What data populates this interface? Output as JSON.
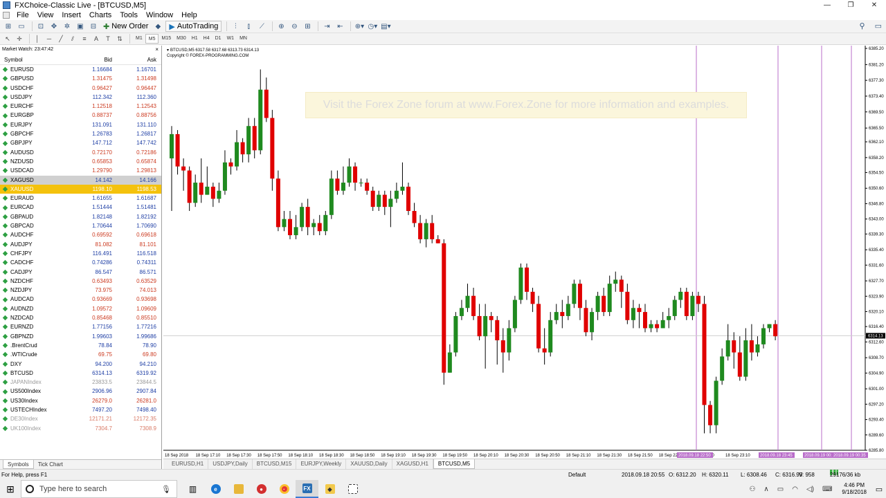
{
  "window": {
    "title": "FXChoice-Classic Live - [BTCUSD,M5]",
    "controls": [
      "—",
      "❐",
      "✕"
    ]
  },
  "menu": [
    "File",
    "View",
    "Insert",
    "Charts",
    "Tools",
    "Window",
    "Help"
  ],
  "toolbar": {
    "new_order": "New Order",
    "autotrading": "AutoTrading"
  },
  "timeframes": [
    "M1",
    "M5",
    "M15",
    "M30",
    "H1",
    "H4",
    "D1",
    "W1",
    "MN"
  ],
  "active_timeframe": "M5",
  "market_watch": {
    "title": "Market Watch: 23:47:42",
    "close": "×",
    "headers": {
      "symbol": "Symbol",
      "bid": "Bid",
      "ask": "Ask"
    },
    "rows": [
      {
        "symbol": "EURUSD",
        "bid": "1.16684",
        "ask": "1.16701",
        "state": "up"
      },
      {
        "symbol": "GBPUSD",
        "bid": "1.31475",
        "ask": "1.31498",
        "state": "down"
      },
      {
        "symbol": "USDCHF",
        "bid": "0.96427",
        "ask": "0.96447",
        "state": "down"
      },
      {
        "symbol": "USDJPY",
        "bid": "112.342",
        "ask": "112.360",
        "state": "up"
      },
      {
        "symbol": "EURCHF",
        "bid": "1.12518",
        "ask": "1.12543",
        "state": "down"
      },
      {
        "symbol": "EURGBP",
        "bid": "0.88737",
        "ask": "0.88756",
        "state": "down"
      },
      {
        "symbol": "EURJPY",
        "bid": "131.091",
        "ask": "131.110",
        "state": "up"
      },
      {
        "symbol": "GBPCHF",
        "bid": "1.26783",
        "ask": "1.26817",
        "state": "up"
      },
      {
        "symbol": "GBPJPY",
        "bid": "147.712",
        "ask": "147.742",
        "state": "up"
      },
      {
        "symbol": "AUDUSD",
        "bid": "0.72170",
        "ask": "0.72186",
        "state": "down"
      },
      {
        "symbol": "NZDUSD",
        "bid": "0.65853",
        "ask": "0.65874",
        "state": "down"
      },
      {
        "symbol": "USDCAD",
        "bid": "1.29790",
        "ask": "1.29813",
        "state": "down"
      },
      {
        "symbol": "XAGUSD",
        "bid": "14.142",
        "ask": "14.166",
        "state": "sel-gray"
      },
      {
        "symbol": "XAUUSD",
        "bid": "1198.10",
        "ask": "1198.53",
        "state": "sel-gold"
      },
      {
        "symbol": "EURAUD",
        "bid": "1.61655",
        "ask": "1.61687",
        "state": "up"
      },
      {
        "symbol": "EURCAD",
        "bid": "1.51444",
        "ask": "1.51481",
        "state": "up"
      },
      {
        "symbol": "GBPAUD",
        "bid": "1.82148",
        "ask": "1.82192",
        "state": "up"
      },
      {
        "symbol": "GBPCAD",
        "bid": "1.70644",
        "ask": "1.70690",
        "state": "up"
      },
      {
        "symbol": "AUDCHF",
        "bid": "0.69592",
        "ask": "0.69618",
        "state": "down"
      },
      {
        "symbol": "AUDJPY",
        "bid": "81.082",
        "ask": "81.101",
        "state": "down"
      },
      {
        "symbol": "CHFJPY",
        "bid": "116.491",
        "ask": "116.518",
        "state": "up"
      },
      {
        "symbol": "CADCHF",
        "bid": "0.74286",
        "ask": "0.74311",
        "state": "up"
      },
      {
        "symbol": "CADJPY",
        "bid": "86.547",
        "ask": "86.571",
        "state": "up"
      },
      {
        "symbol": "NZDCHF",
        "bid": "0.63493",
        "ask": "0.63529",
        "state": "down"
      },
      {
        "symbol": "NZDJPY",
        "bid": "73.975",
        "ask": "74.013",
        "state": "down"
      },
      {
        "symbol": "AUDCAD",
        "bid": "0.93669",
        "ask": "0.93698",
        "state": "down"
      },
      {
        "symbol": "AUDNZD",
        "bid": "1.09572",
        "ask": "1.09609",
        "state": "down"
      },
      {
        "symbol": "NZDCAD",
        "bid": "0.85468",
        "ask": "0.85510",
        "state": "down"
      },
      {
        "symbol": "EURNZD",
        "bid": "1.77156",
        "ask": "1.77216",
        "state": "up"
      },
      {
        "symbol": "GBPNZD",
        "bid": "1.99603",
        "ask": "1.99686",
        "state": "up"
      },
      {
        "symbol": ".BrentCrud",
        "bid": "78.84",
        "ask": "78.90",
        "state": "up"
      },
      {
        "symbol": ".WTICrude",
        "bid": "69.75",
        "ask": "69.80",
        "state": "down"
      },
      {
        "symbol": "DXY",
        "bid": "94.200",
        "ask": "94.210",
        "state": "up"
      },
      {
        "symbol": "BTCUSD",
        "bid": "6314.13",
        "ask": "6319.92",
        "state": "up"
      },
      {
        "symbol": "JAPANIndex",
        "bid": "23833.5",
        "ask": "23844.5",
        "state": "off"
      },
      {
        "symbol": "US500Index",
        "bid": "2906.96",
        "ask": "2907.84",
        "state": "up"
      },
      {
        "symbol": "US30Index",
        "bid": "26279.0",
        "ask": "26281.0",
        "state": "down"
      },
      {
        "symbol": "USTECHIndex",
        "bid": "7497.20",
        "ask": "7498.40",
        "state": "up"
      },
      {
        "symbol": "DE30Index",
        "bid": "12171.21",
        "ask": "12172.35",
        "state": "off down"
      },
      {
        "symbol": "UK100Index",
        "bid": "7304.7",
        "ask": "7308.9",
        "state": "off down"
      }
    ],
    "tabs": [
      "Symbols",
      "Tick Chart"
    ]
  },
  "chart": {
    "header_line": "BTCUSD,M5  6317.58 6317.68 6313.73 6314.13",
    "copyright": "Copyright © FOREX-PROGRAMMING.COM",
    "banner": "Visit the Forex Zone forum at www.Forex.Zone for more information and examples.",
    "current_price_label": "6314.13"
  },
  "chart_data": {
    "type": "candlestick",
    "symbol": "BTCUSD",
    "timeframe": "M5",
    "y_ticks": [
      "6385.20",
      "6381.20",
      "6377.30",
      "6373.40",
      "6369.50",
      "6365.50",
      "6362.10",
      "6358.20",
      "6354.50",
      "6350.60",
      "6346.80",
      "6343.00",
      "6339.30",
      "6335.40",
      "6331.60",
      "6327.70",
      "6323.90",
      "6320.10",
      "6316.40",
      "6312.60",
      "6308.70",
      "6304.90",
      "6301.00",
      "6297.20",
      "6293.40",
      "6289.60",
      "6285.80"
    ],
    "y_range": [
      6285.8,
      6385.2
    ],
    "x_labels": [
      "18 Sep 2018",
      "18 Sep 17:10",
      "18 Sep 17:30",
      "18 Sep 17:50",
      "18 Sep 18:10",
      "18 Sep 18:30",
      "18 Sep 18:50",
      "18 Sep 19:10",
      "18 Sep 19:30",
      "18 Sep 19:50",
      "18 Sep 20:10",
      "18 Sep 20:30",
      "18 Sep 20:50",
      "18 Sep 21:10",
      "18 Sep 21:30",
      "18 Sep 21:50",
      "18 Sep 22:10",
      "18 Sep 22:30",
      "18 Sep 23:10"
    ],
    "x_highlight_labels": [
      "2018.09.18 22:50",
      "2018.09.18 23:45",
      "2018.09.19 00:00",
      "2018.09.19 00:35"
    ],
    "candles": [
      [
        6358,
        6364,
        6366,
        6345
      ],
      [
        6364,
        6356,
        6365,
        6354
      ],
      [
        6356,
        6355,
        6358,
        6350
      ],
      [
        6355,
        6347,
        6356,
        6345
      ],
      [
        6347,
        6352,
        6354,
        6346
      ],
      [
        6352,
        6349,
        6358,
        6347
      ],
      [
        6349,
        6351,
        6356,
        6349
      ],
      [
        6351,
        6348,
        6352,
        6346
      ],
      [
        6348,
        6350,
        6352,
        6347
      ],
      [
        6350,
        6357,
        6360,
        6349
      ],
      [
        6357,
        6356,
        6358,
        6354
      ],
      [
        6356,
        6362,
        6365,
        6355
      ],
      [
        6362,
        6359,
        6363,
        6357
      ],
      [
        6359,
        6366,
        6368,
        6357
      ],
      [
        6366,
        6360,
        6368,
        6358
      ],
      [
        6360,
        6375,
        6380,
        6359
      ],
      [
        6375,
        6368,
        6378,
        6367
      ],
      [
        6368,
        6353,
        6370,
        6350
      ],
      [
        6353,
        6341,
        6355,
        6340
      ],
      [
        6341,
        6343,
        6345,
        6340
      ],
      [
        6343,
        6339,
        6345,
        6338
      ],
      [
        6339,
        6341,
        6344,
        6338
      ],
      [
        6341,
        6346,
        6347,
        6340
      ],
      [
        6346,
        6341,
        6348,
        6339
      ],
      [
        6341,
        6342,
        6343,
        6339
      ],
      [
        6342,
        6340,
        6344,
        6339
      ],
      [
        6340,
        6344,
        6345,
        6339
      ],
      [
        6344,
        6353,
        6355,
        6343
      ],
      [
        6353,
        6350,
        6355,
        6349
      ],
      [
        6350,
        6352,
        6356,
        6349
      ],
      [
        6352,
        6356,
        6358,
        6351
      ],
      [
        6356,
        6352,
        6357,
        6350
      ],
      [
        6352,
        6352,
        6353,
        6351
      ],
      [
        6352,
        6350,
        6353,
        6349
      ],
      [
        6350,
        6346,
        6351,
        6345
      ],
      [
        6346,
        6349,
        6350,
        6345
      ],
      [
        6349,
        6346,
        6350,
        6344
      ],
      [
        6346,
        6348,
        6350,
        6341
      ],
      [
        6348,
        6350,
        6352,
        6347
      ],
      [
        6350,
        6351,
        6357,
        6349
      ],
      [
        6351,
        6345,
        6352,
        6344
      ],
      [
        6345,
        6342,
        6347,
        6341
      ],
      [
        6342,
        6338,
        6344,
        6337
      ],
      [
        6338,
        6342,
        6343,
        6336
      ],
      [
        6342,
        6338,
        6344,
        6337
      ],
      [
        6338,
        6337,
        6339,
        6337
      ],
      [
        6337,
        6305,
        6338,
        6302
      ],
      [
        6305,
        6310,
        6312,
        6305
      ],
      [
        6310,
        6319,
        6320,
        6309
      ],
      [
        6319,
        6321,
        6323,
        6318
      ],
      [
        6321,
        6324,
        6327,
        6320
      ],
      [
        6324,
        6319,
        6326,
        6318
      ],
      [
        6319,
        6314,
        6322,
        6313
      ],
      [
        6314,
        6319,
        6322,
        6306
      ],
      [
        6319,
        6318,
        6320,
        6315
      ],
      [
        6318,
        6313,
        6319,
        6307
      ],
      [
        6313,
        6310,
        6316,
        6305
      ],
      [
        6310,
        6316,
        6318,
        6308
      ],
      [
        6316,
        6323,
        6324,
        6315
      ],
      [
        6323,
        6331,
        6332,
        6322
      ],
      [
        6331,
        6325,
        6332,
        6323
      ],
      [
        6325,
        6322,
        6326,
        6320
      ],
      [
        6322,
        6311,
        6324,
        6310
      ],
      [
        6311,
        6310,
        6316,
        6307
      ],
      [
        6310,
        6318,
        6320,
        6309
      ],
      [
        6318,
        6320,
        6322,
        6317
      ],
      [
        6320,
        6319,
        6323,
        6316
      ],
      [
        6319,
        6322,
        6324,
        6318
      ],
      [
        6322,
        6327,
        6328,
        6321
      ],
      [
        6327,
        6321,
        6328,
        6318
      ],
      [
        6321,
        6315,
        6323,
        6314
      ],
      [
        6315,
        6320,
        6321,
        6313
      ],
      [
        6320,
        6324,
        6325,
        6318
      ],
      [
        6324,
        6320,
        6326,
        6319
      ],
      [
        6320,
        6327,
        6329,
        6319
      ],
      [
        6327,
        6328,
        6330,
        6325
      ],
      [
        6328,
        6325,
        6329,
        6321
      ],
      [
        6325,
        6318,
        6327,
        6317
      ],
      [
        6318,
        6321,
        6323,
        6316
      ],
      [
        6321,
        6320,
        6322,
        6316
      ],
      [
        6320,
        6316,
        6322,
        6315
      ],
      [
        6316,
        6317,
        6318,
        6315
      ],
      [
        6317,
        6316,
        6318,
        6315
      ],
      [
        6316,
        6318,
        6320,
        6316
      ],
      [
        6318,
        6319,
        6321,
        6316
      ],
      [
        6319,
        6323,
        6324,
        6318
      ],
      [
        6323,
        6325,
        6326,
        6321
      ],
      [
        6325,
        6319,
        6326,
        6318
      ],
      [
        6319,
        6324,
        6325,
        6318
      ],
      [
        6324,
        6322,
        6325,
        6320
      ],
      [
        6322,
        6297,
        6324,
        6290
      ],
      [
        6297,
        6292,
        6298,
        6290
      ],
      [
        6292,
        6303,
        6304,
        6290
      ],
      [
        6303,
        6309,
        6311,
        6302
      ],
      [
        6309,
        6313,
        6317,
        6308
      ],
      [
        6313,
        6310,
        6315,
        6306
      ],
      [
        6310,
        6304,
        6314,
        6303
      ],
      [
        6304,
        6313,
        6316,
        6303
      ],
      [
        6313,
        6310,
        6317,
        6308
      ],
      [
        6310,
        6312,
        6314,
        6309
      ],
      [
        6312,
        6316,
        6317,
        6311
      ],
      [
        6316,
        6317,
        6317,
        6315
      ],
      [
        6317,
        6314,
        6318,
        6313
      ]
    ],
    "candle_format": [
      "open",
      "close",
      "high",
      "low"
    ],
    "period_separators": [
      "2018.09.18 22:50",
      "2018.09.18 23:45",
      "2018.09.19 00:00",
      "2018.09.19 00:35"
    ],
    "colors": {
      "bull": "#1f8a1f",
      "bear": "#e00000",
      "separator": "#b86cc9",
      "bid_line": "#9a9a9a"
    }
  },
  "chart_tabs": [
    "EURUSD,H1",
    "USDJPY,Daily",
    "BTCUSD,M15",
    "EURJPY,Weekly",
    "XAUUSD,Daily",
    "XAGUSD,H1",
    "BTCUSD,M5"
  ],
  "active_chart_tab": "BTCUSD,M5",
  "statusbar": {
    "help": "For Help, press F1",
    "profile": "Default",
    "datetime": "2018.09.18 20:55",
    "open": "O: 6312.20",
    "high": "H: 6320.11",
    "low": "L: 6308.46",
    "close": "C: 6316.99",
    "volume": "V: 958",
    "traffic": "29176/36 kb"
  },
  "taskbar": {
    "search_placeholder": "Type here to search",
    "time": "4:46 PM",
    "date": "9/18/2018"
  }
}
